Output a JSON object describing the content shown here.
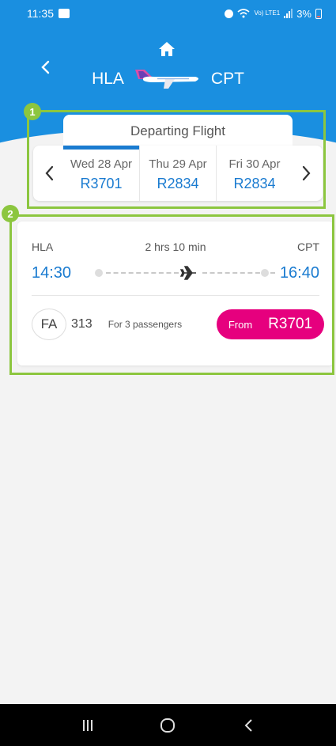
{
  "status_bar": {
    "time": "11:35",
    "network": "Vo) LTE1",
    "battery": "3%"
  },
  "header": {
    "origin": "HLA",
    "destination": "CPT"
  },
  "date_selector": {
    "title": "Departing Flight",
    "dates": [
      {
        "label": "Wed 28 Apr",
        "price": "R3701",
        "active": true
      },
      {
        "label": "Thu 29 Apr",
        "price": "R2834",
        "active": false
      },
      {
        "label": "Fri 30 Apr",
        "price": "R2834",
        "active": false
      }
    ]
  },
  "annotations": {
    "badge_1": "1",
    "badge_2": "2"
  },
  "flight": {
    "origin": "HLA",
    "destination": "CPT",
    "duration": "2 hrs 10 min",
    "depart_time": "14:30",
    "arrive_time": "16:40",
    "airline_code": "FA",
    "flight_number": "313",
    "passengers": "For 3 passengers",
    "from_label": "From",
    "price": "R3701"
  },
  "colors": {
    "header_blue": "#1a8fe0",
    "accent_blue": "#1a7bd0",
    "highlight_green": "#8cc63f",
    "price_pink": "#e6007e"
  }
}
